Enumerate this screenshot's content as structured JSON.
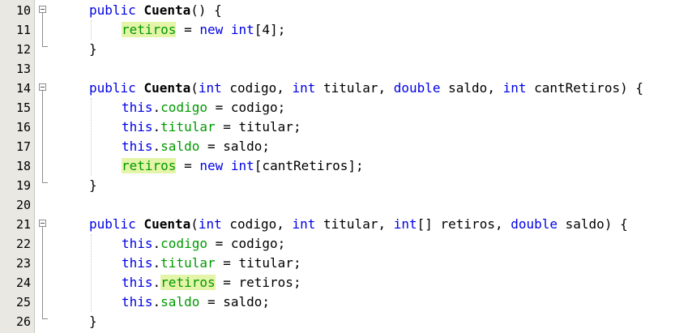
{
  "editor": {
    "lines": [
      {
        "n": "10",
        "tokens": [
          [
            "kw",
            "public"
          ],
          [
            "t",
            " "
          ],
          [
            "cn",
            "Cuenta"
          ],
          [
            "t",
            "() {"
          ]
        ],
        "indent": 1
      },
      {
        "n": "11",
        "tokens": [
          [
            "hl",
            "retiros"
          ],
          [
            "t",
            " = "
          ],
          [
            "kw",
            "new"
          ],
          [
            "t",
            " "
          ],
          [
            "kw",
            "int"
          ],
          [
            "t",
            "[4];"
          ]
        ],
        "indent": 2
      },
      {
        "n": "12",
        "tokens": [
          [
            "t",
            "}"
          ]
        ],
        "indent": 1
      },
      {
        "n": "13",
        "tokens": [],
        "indent": 0
      },
      {
        "n": "14",
        "tokens": [
          [
            "kw",
            "public"
          ],
          [
            "t",
            " "
          ],
          [
            "cn",
            "Cuenta"
          ],
          [
            "t",
            "("
          ],
          [
            "kw",
            "int"
          ],
          [
            "t",
            " codigo, "
          ],
          [
            "kw",
            "int"
          ],
          [
            "t",
            " titular, "
          ],
          [
            "kw",
            "double"
          ],
          [
            "t",
            " saldo, "
          ],
          [
            "kw",
            "int"
          ],
          [
            "t",
            " cantRetiros) {"
          ]
        ],
        "indent": 1
      },
      {
        "n": "15",
        "tokens": [
          [
            "kw",
            "this"
          ],
          [
            "t",
            "."
          ],
          [
            "fd",
            "codigo"
          ],
          [
            "t",
            " = codigo;"
          ]
        ],
        "indent": 2
      },
      {
        "n": "16",
        "tokens": [
          [
            "kw",
            "this"
          ],
          [
            "t",
            "."
          ],
          [
            "fd",
            "titular"
          ],
          [
            "t",
            " = titular;"
          ]
        ],
        "indent": 2
      },
      {
        "n": "17",
        "tokens": [
          [
            "kw",
            "this"
          ],
          [
            "t",
            "."
          ],
          [
            "fd",
            "saldo"
          ],
          [
            "t",
            " = saldo;"
          ]
        ],
        "indent": 2
      },
      {
        "n": "18",
        "tokens": [
          [
            "hl",
            "retiros"
          ],
          [
            "t",
            " = "
          ],
          [
            "kw",
            "new"
          ],
          [
            "t",
            " "
          ],
          [
            "kw",
            "int"
          ],
          [
            "t",
            "[cantRetiros];"
          ]
        ],
        "indent": 2
      },
      {
        "n": "19",
        "tokens": [
          [
            "t",
            "}"
          ]
        ],
        "indent": 1
      },
      {
        "n": "20",
        "tokens": [],
        "indent": 0
      },
      {
        "n": "21",
        "tokens": [
          [
            "kw",
            "public"
          ],
          [
            "t",
            " "
          ],
          [
            "cn",
            "Cuenta"
          ],
          [
            "t",
            "("
          ],
          [
            "kw",
            "int"
          ],
          [
            "t",
            " codigo, "
          ],
          [
            "kw",
            "int"
          ],
          [
            "t",
            " titular, "
          ],
          [
            "kw",
            "int"
          ],
          [
            "t",
            "[] retiros, "
          ],
          [
            "kw",
            "double"
          ],
          [
            "t",
            " saldo) {"
          ]
        ],
        "indent": 1
      },
      {
        "n": "22",
        "tokens": [
          [
            "kw",
            "this"
          ],
          [
            "t",
            "."
          ],
          [
            "fd",
            "codigo"
          ],
          [
            "t",
            " = codigo;"
          ]
        ],
        "indent": 2
      },
      {
        "n": "23",
        "tokens": [
          [
            "kw",
            "this"
          ],
          [
            "t",
            "."
          ],
          [
            "fd",
            "titular"
          ],
          [
            "t",
            " = titular;"
          ]
        ],
        "indent": 2
      },
      {
        "n": "24",
        "tokens": [
          [
            "kw",
            "this"
          ],
          [
            "t",
            "."
          ],
          [
            "hl",
            "retiros"
          ],
          [
            "t",
            " = retiros;"
          ]
        ],
        "indent": 2
      },
      {
        "n": "25",
        "tokens": [
          [
            "kw",
            "this"
          ],
          [
            "t",
            "."
          ],
          [
            "fd",
            "saldo"
          ],
          [
            "t",
            " = saldo;"
          ]
        ],
        "indent": 2
      },
      {
        "n": "26",
        "tokens": [
          [
            "t",
            "}"
          ]
        ],
        "indent": 1
      }
    ],
    "fold_open_lines": [
      "10",
      "14",
      "21"
    ],
    "fold_close_lines": [
      "12",
      "19",
      "26"
    ],
    "colors": {
      "keyword": "#0000e6",
      "field": "#009900",
      "highlight_bg": "#e4f4a8",
      "gutter_bg": "#e9e8e2"
    }
  }
}
